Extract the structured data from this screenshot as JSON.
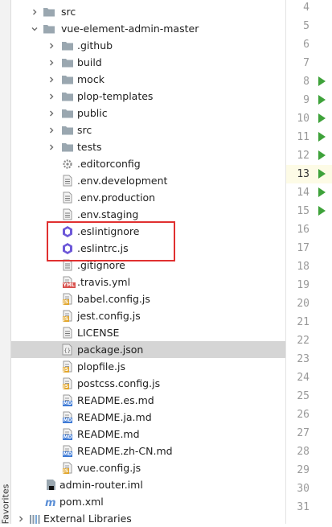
{
  "tree": {
    "rows": [
      {
        "label": "src",
        "type": "folder",
        "expanded": false
      },
      {
        "label": "vue-element-admin-master",
        "type": "folder",
        "expanded": true
      },
      {
        "label": ".github",
        "type": "folder",
        "expanded": false
      },
      {
        "label": "build",
        "type": "folder",
        "expanded": false
      },
      {
        "label": "mock",
        "type": "folder",
        "expanded": false
      },
      {
        "label": "plop-templates",
        "type": "folder",
        "expanded": false
      },
      {
        "label": "public",
        "type": "folder",
        "expanded": false
      },
      {
        "label": "src",
        "type": "folder",
        "expanded": false
      },
      {
        "label": "tests",
        "type": "folder",
        "expanded": false
      },
      {
        "label": ".editorconfig",
        "type": "gear"
      },
      {
        "label": ".env.development",
        "type": "text"
      },
      {
        "label": ".env.production",
        "type": "text"
      },
      {
        "label": ".env.staging",
        "type": "text"
      },
      {
        "label": ".eslintignore",
        "type": "eslint"
      },
      {
        "label": ".eslintrc.js",
        "type": "eslint"
      },
      {
        "label": ".gitignore",
        "type": "text"
      },
      {
        "label": ".travis.yml",
        "type": "yml",
        "badge": "YML"
      },
      {
        "label": "babel.config.js",
        "type": "js",
        "badge": "JS"
      },
      {
        "label": "jest.config.js",
        "type": "js",
        "badge": "JS"
      },
      {
        "label": "LICENSE",
        "type": "text"
      },
      {
        "label": "package.json",
        "type": "json",
        "selected": true
      },
      {
        "label": "plopfile.js",
        "type": "js",
        "badge": "JS"
      },
      {
        "label": "postcss.config.js",
        "type": "js",
        "badge": "JS"
      },
      {
        "label": "README.es.md",
        "type": "md",
        "badge": "MD"
      },
      {
        "label": "README.ja.md",
        "type": "md",
        "badge": "MD"
      },
      {
        "label": "README.md",
        "type": "md",
        "badge": "MD"
      },
      {
        "label": "README.zh-CN.md",
        "type": "md",
        "badge": "MD"
      },
      {
        "label": "vue.config.js",
        "type": "js",
        "badge": "JS"
      },
      {
        "label": "admin-router.iml",
        "type": "iml"
      },
      {
        "label": "pom.xml",
        "type": "maven"
      },
      {
        "label": "External Libraries",
        "type": "libs",
        "expanded": false
      }
    ]
  },
  "gutter": {
    "lines": [
      "4",
      "5",
      "6",
      "7",
      "8",
      "9",
      "10",
      "11",
      "12",
      "13",
      "14",
      "15",
      "16",
      "17",
      "18",
      "19",
      "20",
      "21",
      "22",
      "23",
      "24",
      "25",
      "26",
      "27",
      "28",
      "29",
      "30",
      "31"
    ],
    "current_line": "13",
    "run_lines": [
      "8",
      "9",
      "10",
      "11",
      "12",
      "13",
      "14",
      "15"
    ]
  },
  "sidebar": {
    "favorites_label": "Favorites"
  },
  "colors": {
    "folder": "#9aa7b0",
    "run_marker": "#3ea23a",
    "highlight_box": "#e03030",
    "selection": "#d5d5d5"
  }
}
